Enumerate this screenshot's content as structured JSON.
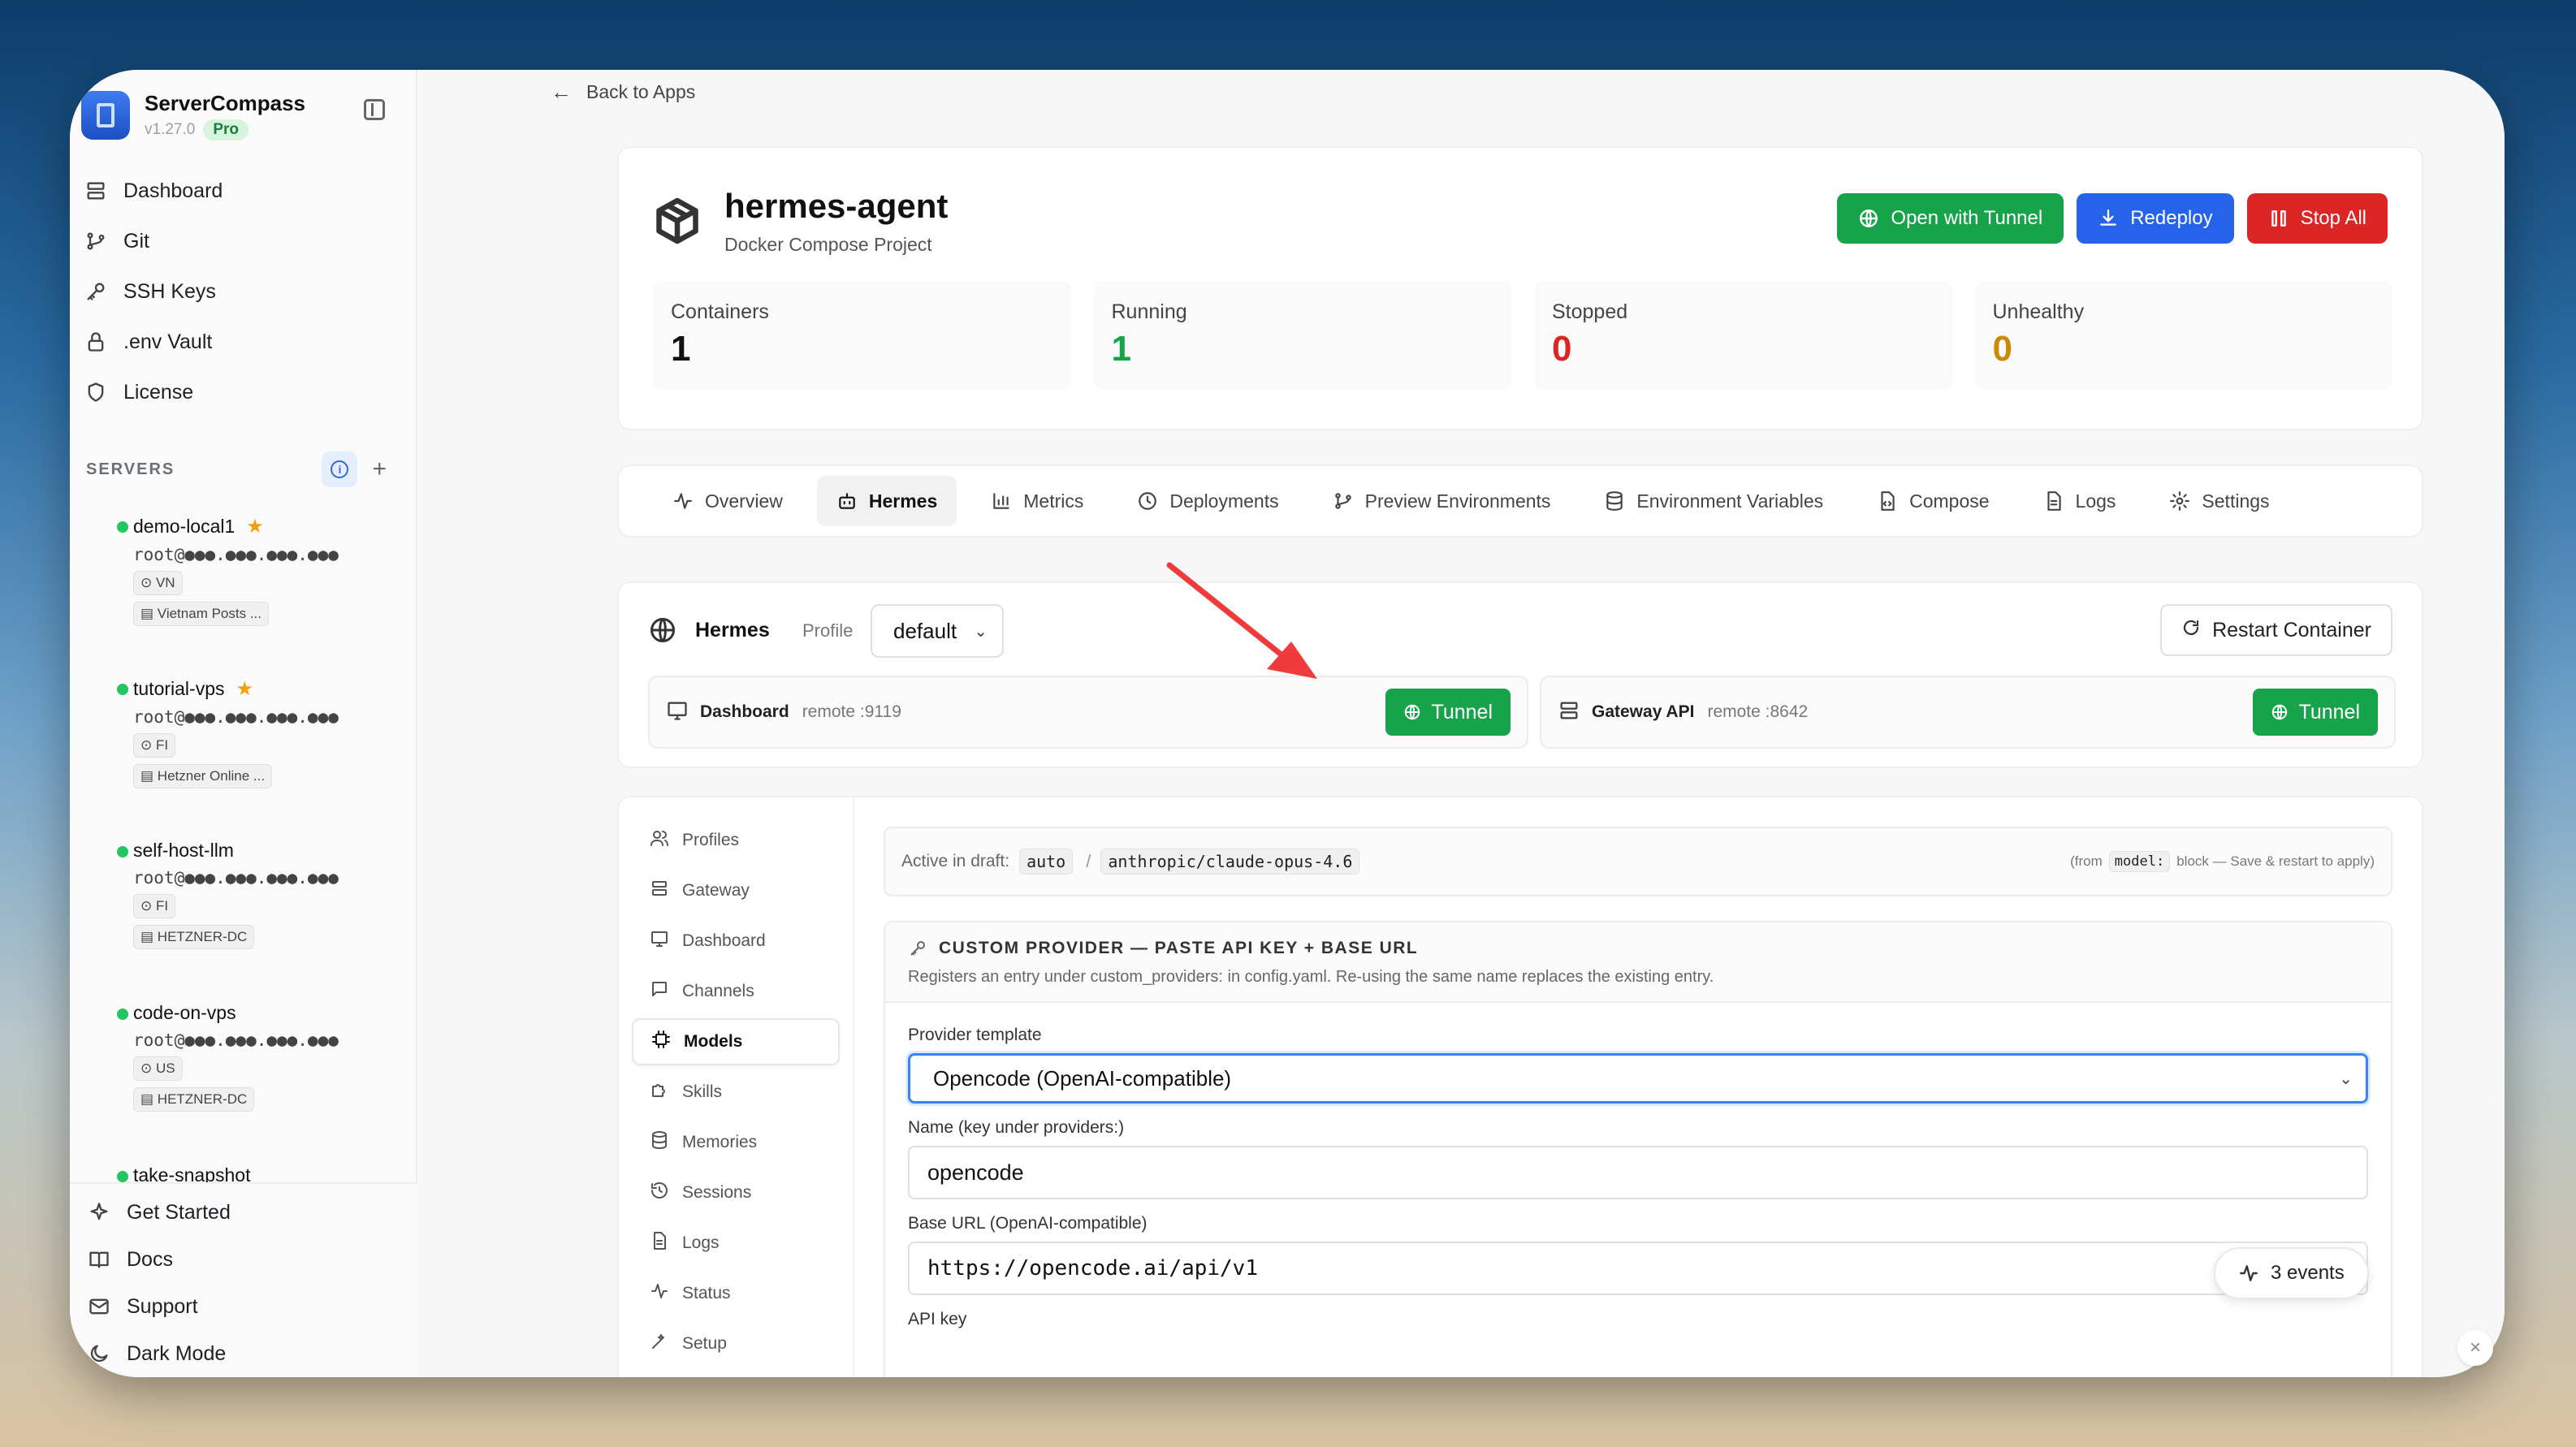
{
  "sidebar": {
    "brand": {
      "name": "ServerCompass",
      "version": "v1.27.0",
      "badge": "Pro"
    },
    "nav": [
      {
        "label": "Dashboard",
        "icon": "database-icon"
      },
      {
        "label": "Git",
        "icon": "git-branch-icon"
      },
      {
        "label": "SSH Keys",
        "icon": "key-icon"
      },
      {
        "label": ".env Vault",
        "icon": "lock-icon"
      },
      {
        "label": "License",
        "icon": "shield-icon"
      }
    ],
    "servers_title": "SERVERS",
    "servers": [
      {
        "name": "demo-local1",
        "starred": true,
        "host": "root@●●●.●●●.●●●.●●●",
        "country": "VN",
        "provider": "Vietnam Posts ..."
      },
      {
        "name": "tutorial-vps",
        "starred": true,
        "host": "root@●●●.●●●.●●●.●●●",
        "country": "FI",
        "provider": "Hetzner Online ..."
      },
      {
        "name": "self-host-llm",
        "starred": false,
        "host": "root@●●●.●●●.●●●.●●●",
        "country": "FI",
        "provider": "HETZNER-DC"
      },
      {
        "name": "code-on-vps",
        "starred": false,
        "host": "root@●●●.●●●.●●●.●●●",
        "country": "US",
        "provider": "HETZNER-DC"
      },
      {
        "name": "take-snapshot"
      }
    ],
    "bottom": [
      {
        "label": "Get Started",
        "icon": "sparkles-icon"
      },
      {
        "label": "Docs",
        "icon": "book-icon"
      },
      {
        "label": "Support",
        "icon": "mail-icon"
      },
      {
        "label": "Dark Mode",
        "icon": "moon-icon"
      }
    ]
  },
  "main": {
    "back_label": "Back to Apps",
    "app": {
      "title": "hermes-agent",
      "subtitle": "Docker Compose Project"
    },
    "actions": {
      "open_tunnel": "Open with Tunnel",
      "redeploy": "Redeploy",
      "stop_all": "Stop All"
    },
    "stats": [
      {
        "label": "Containers",
        "value": "1",
        "color": "#111111"
      },
      {
        "label": "Running",
        "value": "1",
        "color": "#16a34a"
      },
      {
        "label": "Stopped",
        "value": "0",
        "color": "#dc2626"
      },
      {
        "label": "Unhealthy",
        "value": "0",
        "color": "#ca8a04"
      }
    ],
    "tabs": [
      {
        "label": "Overview",
        "icon": "activity-icon"
      },
      {
        "label": "Hermes",
        "icon": "bot-icon",
        "active": true
      },
      {
        "label": "Metrics",
        "icon": "bar-chart-icon"
      },
      {
        "label": "Deployments",
        "icon": "clock-icon"
      },
      {
        "label": "Preview Environments",
        "icon": "git-branch-icon"
      },
      {
        "label": "Environment Variables",
        "icon": "database-icon"
      },
      {
        "label": "Compose",
        "icon": "file-code-icon"
      },
      {
        "label": "Logs",
        "icon": "file-text-icon"
      },
      {
        "label": "Settings",
        "icon": "gear-icon"
      }
    ],
    "hermes": {
      "title": "Hermes",
      "profile_label": "Profile",
      "profile_value": "default",
      "restart_label": "Restart Container",
      "endpoints": [
        {
          "name": "Dashboard",
          "remote": "remote :9119",
          "button": "Tunnel"
        },
        {
          "name": "Gateway API",
          "remote": "remote :8642",
          "button": "Tunnel"
        }
      ]
    },
    "subnav": [
      {
        "label": "Profiles",
        "icon": "users-icon"
      },
      {
        "label": "Gateway",
        "icon": "server-icon"
      },
      {
        "label": "Dashboard",
        "icon": "monitor-icon"
      },
      {
        "label": "Channels",
        "icon": "message-icon"
      },
      {
        "label": "Models",
        "icon": "cpu-icon",
        "active": true
      },
      {
        "label": "Skills",
        "icon": "puzzle-icon"
      },
      {
        "label": "Memories",
        "icon": "database-icon"
      },
      {
        "label": "Sessions",
        "icon": "history-icon"
      },
      {
        "label": "Logs",
        "icon": "file-text-icon"
      },
      {
        "label": "Status",
        "icon": "activity-icon"
      },
      {
        "label": "Setup",
        "icon": "wand-icon"
      }
    ],
    "draft": {
      "label": "Active in draft:",
      "chip1": "auto",
      "sep": "/",
      "chip2": "anthropic/claude-opus-4.6",
      "note_pre": "(from",
      "note_code": "model:",
      "note_post": "block — Save & restart to apply)"
    },
    "provider": {
      "title": "CUSTOM PROVIDER — PASTE API KEY + BASE URL",
      "description": "Registers an entry under custom_providers: in config.yaml. Re-using the same name replaces the existing entry.",
      "template_label": "Provider template",
      "template_value": "Opencode (OpenAI-compatible)",
      "name_label": "Name (key under providers:)",
      "name_value": "opencode",
      "url_label": "Base URL (OpenAI-compatible)",
      "url_value": "https://opencode.ai/api/v1",
      "apikey_label": "API key"
    },
    "events_label": "3 events"
  }
}
